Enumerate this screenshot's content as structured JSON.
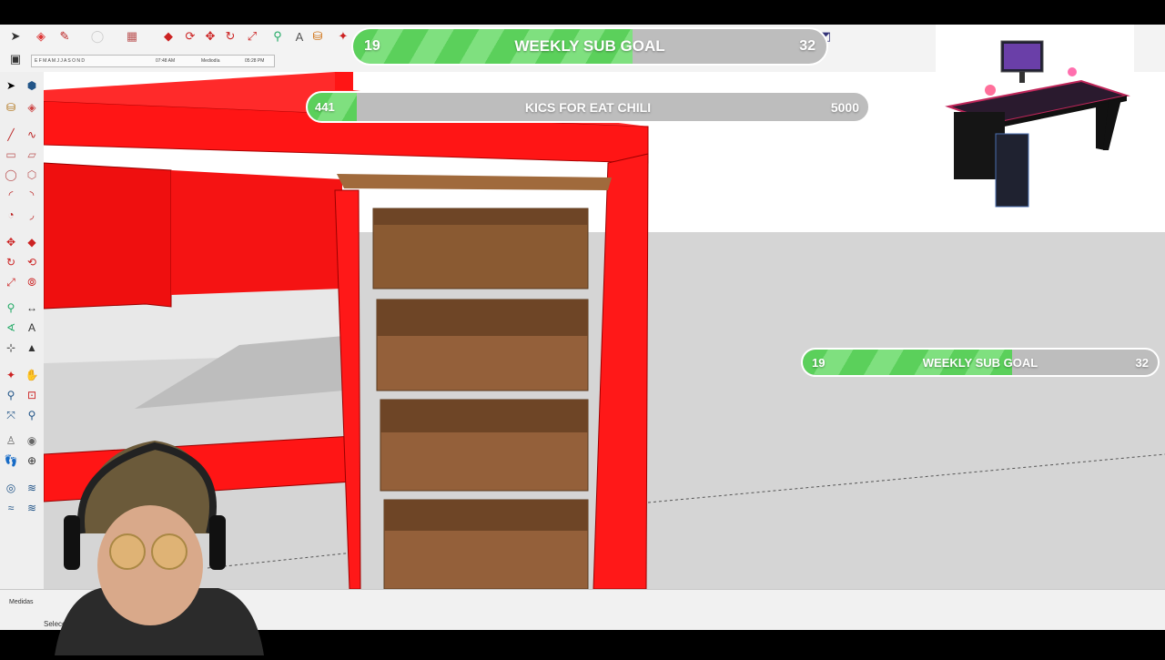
{
  "top_goal": {
    "current": "19",
    "title": "WEEKLY SUB GOAL",
    "target": "32",
    "progress": 0.59
  },
  "kick_goal": {
    "current": "441",
    "title": "KICS FOR EAT CHILI",
    "target": "5000",
    "progress": 0.088
  },
  "side_goal": {
    "current": "19",
    "title": "WEEKLY SUB GOAL",
    "target": "32",
    "progress": 0.59
  },
  "shadow_bar": {
    "months": "E F M A M J J A S O N D",
    "time_start": "07:48 AM",
    "mid_label": "Mediodía",
    "time_end": "05:28 PM"
  },
  "status": {
    "measurements_label": "Medidas",
    "prompt": "Selecc"
  },
  "model": {
    "desk_color": "#ff1010",
    "drawer_color": "#8a5a32"
  },
  "icons": {
    "top": [
      "select-arrow-icon",
      "eraser-icon",
      "pencil-icon",
      "shapes-icon",
      "push-pull-icon",
      "move-icon",
      "rotate-icon",
      "scale-icon",
      "tape-measure-icon",
      "text-icon",
      "paint-bucket-icon",
      "orbit-icon"
    ]
  }
}
